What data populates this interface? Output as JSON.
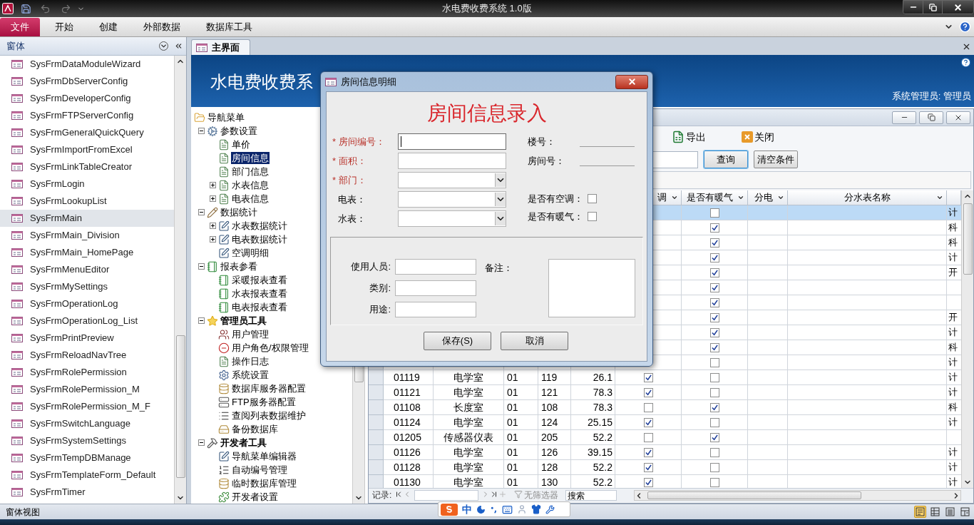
{
  "window": {
    "title": "水电费收费系统 1.0版"
  },
  "ribbon": {
    "tabs": [
      {
        "label": "文件",
        "selected": true
      },
      {
        "label": "开始",
        "selected": false
      },
      {
        "label": "创建",
        "selected": false
      },
      {
        "label": "外部数据",
        "selected": false
      },
      {
        "label": "数据库工具",
        "selected": false
      }
    ]
  },
  "nav_pane": {
    "title": "窗体",
    "items": [
      {
        "label": "SysFrmDataModuleWizard",
        "selected": false
      },
      {
        "label": "SysFrmDbServerConfig",
        "selected": false
      },
      {
        "label": "SysFrmDeveloperConfig",
        "selected": false
      },
      {
        "label": "SysFrmFTPServerConfig",
        "selected": false
      },
      {
        "label": "SysFrmGeneralQuickQuery",
        "selected": false
      },
      {
        "label": "SysFrmImportFromExcel",
        "selected": false
      },
      {
        "label": "SysFrmLinkTableCreator",
        "selected": false
      },
      {
        "label": "SysFrmLogin",
        "selected": false
      },
      {
        "label": "SysFrmLookupList",
        "selected": false
      },
      {
        "label": "SysFrmMain",
        "selected": true
      },
      {
        "label": "SysFrmMain_Division",
        "selected": false
      },
      {
        "label": "SysFrmMain_HomePage",
        "selected": false
      },
      {
        "label": "SysFrmMenuEditor",
        "selected": false
      },
      {
        "label": "SysFrmMySettings",
        "selected": false
      },
      {
        "label": "SysFrmOperationLog",
        "selected": false
      },
      {
        "label": "SysFrmOperationLog_List",
        "selected": false
      },
      {
        "label": "SysFrmPrintPreview",
        "selected": false
      },
      {
        "label": "SysFrmReloadNavTree",
        "selected": false
      },
      {
        "label": "SysFrmRolePermission",
        "selected": false
      },
      {
        "label": "SysFrmRolePermission_M",
        "selected": false
      },
      {
        "label": "SysFrmRolePermission_M_F",
        "selected": false
      },
      {
        "label": "SysFrmSwitchLanguage",
        "selected": false
      },
      {
        "label": "SysFrmSystemSettings",
        "selected": false
      },
      {
        "label": "SysFrmTempDBManage",
        "selected": false
      },
      {
        "label": "SysFrmTemplateForm_Default",
        "selected": false
      },
      {
        "label": "SysFrmTimer",
        "selected": false
      }
    ]
  },
  "document_tabs": [
    {
      "label": "主界面",
      "selected": true
    }
  ],
  "main_form": {
    "title": "水电费收费系",
    "user": "系统管理员: 管理员"
  },
  "nav_tree": {
    "label": "导航菜单",
    "kind": "folder",
    "selected": false,
    "children": [
      {
        "label": "参数设置",
        "kind": "gears",
        "selected": false,
        "bold": false,
        "expanded": true,
        "children": [
          {
            "label": "单价",
            "kind": "doc",
            "selected": false
          },
          {
            "label": "房间信息",
            "kind": "doc",
            "selected": true
          },
          {
            "label": "部门信息",
            "kind": "doc",
            "selected": false
          },
          {
            "label": "水表信息",
            "kind": "doc",
            "selected": false,
            "expanded": false
          },
          {
            "label": "电表信息",
            "kind": "doc",
            "selected": false,
            "expanded": false
          }
        ]
      },
      {
        "label": "数据统计",
        "kind": "pencil",
        "selected": false,
        "bold": false,
        "expanded": true,
        "children": [
          {
            "label": "水表数据统计",
            "kind": "edit",
            "selected": false,
            "expanded": false
          },
          {
            "label": "电表数据统计",
            "kind": "edit",
            "selected": false,
            "expanded": false
          },
          {
            "label": "空调明细",
            "kind": "edit",
            "selected": false
          }
        ]
      },
      {
        "label": "报表参看",
        "kind": "report",
        "selected": false,
        "bold": false,
        "expanded": true,
        "children": [
          {
            "label": "采暖报表查看",
            "kind": "report",
            "selected": false
          },
          {
            "label": "水表报表查看",
            "kind": "report",
            "selected": false
          },
          {
            "label": "电表报表查看",
            "kind": "report",
            "selected": false
          }
        ]
      },
      {
        "label": "管理员工具",
        "kind": "star",
        "selected": false,
        "bold": true,
        "expanded": true,
        "children": [
          {
            "label": "用户管理",
            "kind": "users",
            "selected": false
          },
          {
            "label": "用户角色/权限管理",
            "kind": "minus",
            "selected": false
          },
          {
            "label": "操作日志",
            "kind": "doc",
            "selected": false
          },
          {
            "label": "系统设置",
            "kind": "settings",
            "selected": false
          },
          {
            "label": "数据库服务器配置",
            "kind": "database",
            "selected": false
          },
          {
            "label": "FTP服务器配置",
            "kind": "server",
            "selected": false
          },
          {
            "label": "查阅列表数据维护",
            "kind": "list",
            "selected": false
          },
          {
            "label": "备份数据库",
            "kind": "backup",
            "selected": false
          }
        ]
      },
      {
        "label": "开发者工具",
        "kind": "tools",
        "selected": false,
        "bold": true,
        "expanded": true,
        "children": [
          {
            "label": "导航菜单编辑器",
            "kind": "edit",
            "selected": false
          },
          {
            "label": "自动编号管理",
            "kind": "numbered",
            "selected": false
          },
          {
            "label": "临时数据库管理",
            "kind": "database",
            "selected": false
          },
          {
            "label": "开发者设置",
            "kind": "plugin",
            "selected": false
          }
        ]
      }
    ]
  },
  "subform": {
    "toolbar": [
      {
        "label": "导出",
        "kind": "export"
      },
      {
        "label": "关闭",
        "kind": "close"
      }
    ],
    "search_buttons": [
      {
        "label": "查询",
        "focused": true
      },
      {
        "label": "清空条件",
        "focused": false
      }
    ],
    "columns": [
      {
        "label": "调"
      },
      {
        "label": "是否有暖气"
      },
      {
        "label": "分电"
      },
      {
        "label": "分水表名称"
      }
    ],
    "rows": [
      {
        "selected": true,
        "heating": false,
        "column_10": "计"
      },
      {
        "selected": false,
        "heating": true,
        "column_10": "科"
      },
      {
        "selected": false,
        "heating": true,
        "column_10": "科"
      },
      {
        "selected": false,
        "heating": true,
        "column_10": "计"
      },
      {
        "selected": false,
        "heating": true,
        "column_10": "开"
      },
      {
        "selected": false,
        "heating": true
      },
      {
        "selected": false,
        "heating": true
      },
      {
        "selected": false,
        "heating": true,
        "column_10": "开"
      },
      {
        "selected": false,
        "heating": true,
        "column_10": "计"
      },
      {
        "selected": false,
        "heating": true,
        "column_10": "科"
      },
      {
        "selected": false,
        "heating": false,
        "column_10": "计"
      },
      {
        "selected": false,
        "cells": [
          "01119",
          "电学室",
          "01",
          "119",
          "26.1"
        ],
        "ac": true,
        "heating": false,
        "column_10": "计"
      },
      {
        "selected": false,
        "cells": [
          "01121",
          "电学室",
          "01",
          "121",
          "78.3"
        ],
        "ac": true,
        "heating": false,
        "column_10": "计"
      },
      {
        "selected": false,
        "cells": [
          "01108",
          "长度室",
          "01",
          "108",
          "78.3"
        ],
        "ac": false,
        "heating": true,
        "column_10": "科"
      },
      {
        "selected": false,
        "cells": [
          "01124",
          "电学室",
          "01",
          "124",
          "25.15"
        ],
        "ac": true,
        "heating": false,
        "column_10": "计"
      },
      {
        "selected": false,
        "cells": [
          "01205",
          "传感器仪表",
          "01",
          "205",
          "52.2"
        ],
        "ac": false,
        "heating": true
      },
      {
        "selected": false,
        "cells": [
          "01126",
          "电学室",
          "01",
          "126",
          "39.15"
        ],
        "ac": true,
        "heating": false,
        "column_10": "计"
      },
      {
        "selected": false,
        "cells": [
          "01128",
          "电学室",
          "01",
          "128",
          "52.2"
        ],
        "ac": true,
        "heating": false,
        "column_10": "计"
      },
      {
        "selected": false,
        "cells": [
          "01130",
          "电学室",
          "01",
          "130",
          "52.2"
        ],
        "ac": true,
        "heating": false,
        "column_10": "计"
      }
    ],
    "record_nav": {
      "label": "记录:",
      "filter": "无筛选器",
      "search_placeholder": "搜索"
    }
  },
  "dialog": {
    "title": "房间信息明细",
    "heading": "房间信息录入",
    "fields": [
      {
        "label": "* 房间编号：",
        "required": true,
        "kind": "text",
        "focused": true
      },
      {
        "label": "* 面积：",
        "required": true,
        "kind": "text",
        "focused": false
      },
      {
        "label": "* 部门：",
        "required": true,
        "kind": "combo",
        "focused": false
      },
      {
        "label": "电表：",
        "required": false,
        "kind": "combo",
        "focused": false
      },
      {
        "label": "水表：",
        "required": false,
        "kind": "combo",
        "focused": false
      }
    ],
    "info": [
      {
        "label": "楼号："
      },
      {
        "label": "房间号："
      }
    ],
    "checks": [
      {
        "label": "是否有空调：",
        "checked": false
      },
      {
        "label": "是否有暖气：",
        "checked": false
      }
    ],
    "extra_fields": [
      {
        "label": "使用人员:"
      },
      {
        "label": "类别:"
      },
      {
        "label": "用途:"
      }
    ],
    "notes": {
      "label": "备注："
    },
    "buttons": [
      "保存(S)",
      "取消"
    ]
  },
  "ime": {
    "mode": "中"
  },
  "status_bar": {
    "text": "窗体视图",
    "views": [
      {
        "kind": "form",
        "selected": true
      },
      {
        "kind": "datasheet",
        "selected": false
      },
      {
        "kind": "layout",
        "selected": false
      },
      {
        "kind": "design",
        "selected": false
      }
    ]
  }
}
